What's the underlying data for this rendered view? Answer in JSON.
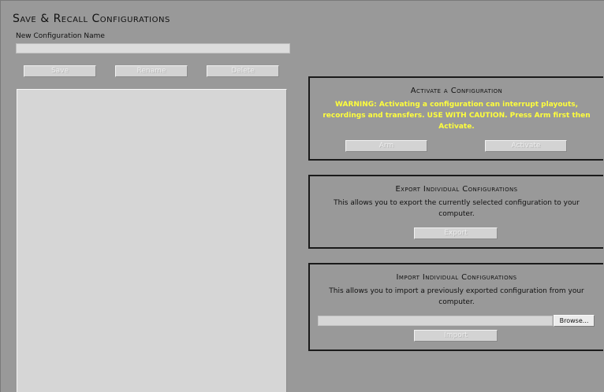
{
  "page": {
    "title": "Save & Recall Configurations"
  },
  "config_name": {
    "label": "New Configuration Name",
    "value": ""
  },
  "actions": {
    "save": "Save",
    "rename": "Rename",
    "delete": "Delete"
  },
  "configurations": [],
  "activate": {
    "title": "Activate a Configuration",
    "warning": "WARNING: Activating a configuration can interrupt playouts, recordings and transfers. USE WITH CAUTION. Press Arm first then Activate.",
    "arm": "Arm",
    "activate": "Activate"
  },
  "export": {
    "title": "Export Individual Configurations",
    "description": "This allows you to export the currently selected configuration to your computer.",
    "button": "Export"
  },
  "import": {
    "title": "Import Individual Configurations",
    "description": "This allows you to import a previously exported configuration from your computer.",
    "file_value": "",
    "browse": "Browse...",
    "button": "Import"
  },
  "colors": {
    "background": "#999999",
    "warning_text": "#ffff3b",
    "panel_border": "#1a1a1a",
    "list_background": "#d6d6d6"
  }
}
